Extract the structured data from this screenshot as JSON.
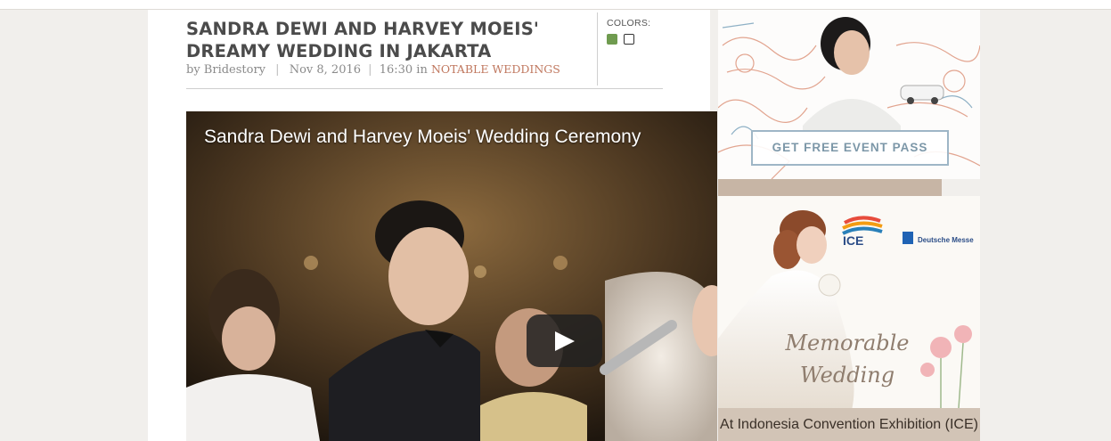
{
  "article": {
    "title_line1": "SANDRA DEWI AND HARVEY MOEIS'",
    "title_line2": "DREAMY WEDDING IN JAKARTA",
    "author": "by Bridestory",
    "date": "Nov 8, 2016",
    "time_in": "16:30 in",
    "category": "NOTABLE WEDDINGS",
    "colors_label": "COLORS:",
    "swatches": [
      "#6f9b4f",
      "#ffffff"
    ]
  },
  "video": {
    "title": "Sandra Dewi and Harvey Moeis' Wedding Ceremony",
    "play_icon": "play-icon"
  },
  "ads": {
    "event_pass_button": "GET FREE EVENT PASS",
    "memorable_line1": "Memorable",
    "memorable_line2": "Wedding",
    "venue": "At Indonesia Convention Exhibition (ICE)",
    "ice_logo_text": "ICE",
    "dm_logo_text": "Deutsche Messe"
  }
}
